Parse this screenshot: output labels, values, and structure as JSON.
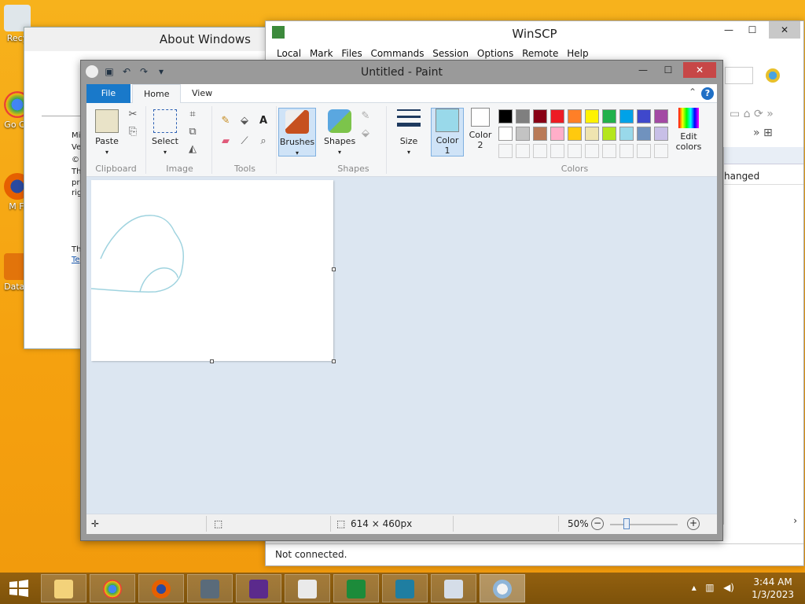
{
  "desktop": {
    "icons": [
      {
        "label": "Recy",
        "name": "recycle-bin"
      },
      {
        "label": "Go Ch",
        "name": "google-chrome"
      },
      {
        "label": "M Fi",
        "name": "mozilla-firefox"
      },
      {
        "label": "DataV",
        "name": "datav"
      }
    ]
  },
  "about_window": {
    "title": "About Windows",
    "frags": [
      "Mi",
      "Ve",
      "©",
      "Th",
      "pre",
      "rig",
      "Th"
    ],
    "link": "Te"
  },
  "winscp": {
    "title": "WinSCP",
    "menu": [
      "Local",
      "Mark",
      "Files",
      "Commands",
      "Session",
      "Options",
      "Remote",
      "Help"
    ],
    "column": "hanged",
    "status": "Not connected."
  },
  "paint": {
    "title": "Untitled - Paint",
    "tabs": {
      "file": "File",
      "home": "Home",
      "view": "View"
    },
    "groups": {
      "clipboard": "Clipboard",
      "image": "Image",
      "tools": "Tools",
      "shapes": "Shapes",
      "colors": "Colors"
    },
    "buttons": {
      "paste": "Paste",
      "select": "Select",
      "brushes": "Brushes",
      "shapes": "Shapes",
      "size": "Size",
      "color1": "Color\n1",
      "color2": "Color\n2",
      "edit_colors": "Edit\ncolors"
    },
    "palette_row1": [
      "#000000",
      "#7f7f7f",
      "#880015",
      "#ed1c24",
      "#ff7f27",
      "#fff200",
      "#22b14c",
      "#00a2e8",
      "#3f48cc",
      "#a349a4"
    ],
    "palette_row2": [
      "#ffffff",
      "#c3c3c3",
      "#b97a57",
      "#ffaec9",
      "#ffc90e",
      "#efe4b0",
      "#b5e61d",
      "#99d9ea",
      "#7092be",
      "#c8bfe7"
    ],
    "color1": "#99d9ea",
    "color2": "#ffffff",
    "status": {
      "dimensions": "614 × 460px",
      "zoom": "50%"
    }
  },
  "taskbar": {
    "time": "3:44 AM",
    "date": "1/3/2023"
  }
}
